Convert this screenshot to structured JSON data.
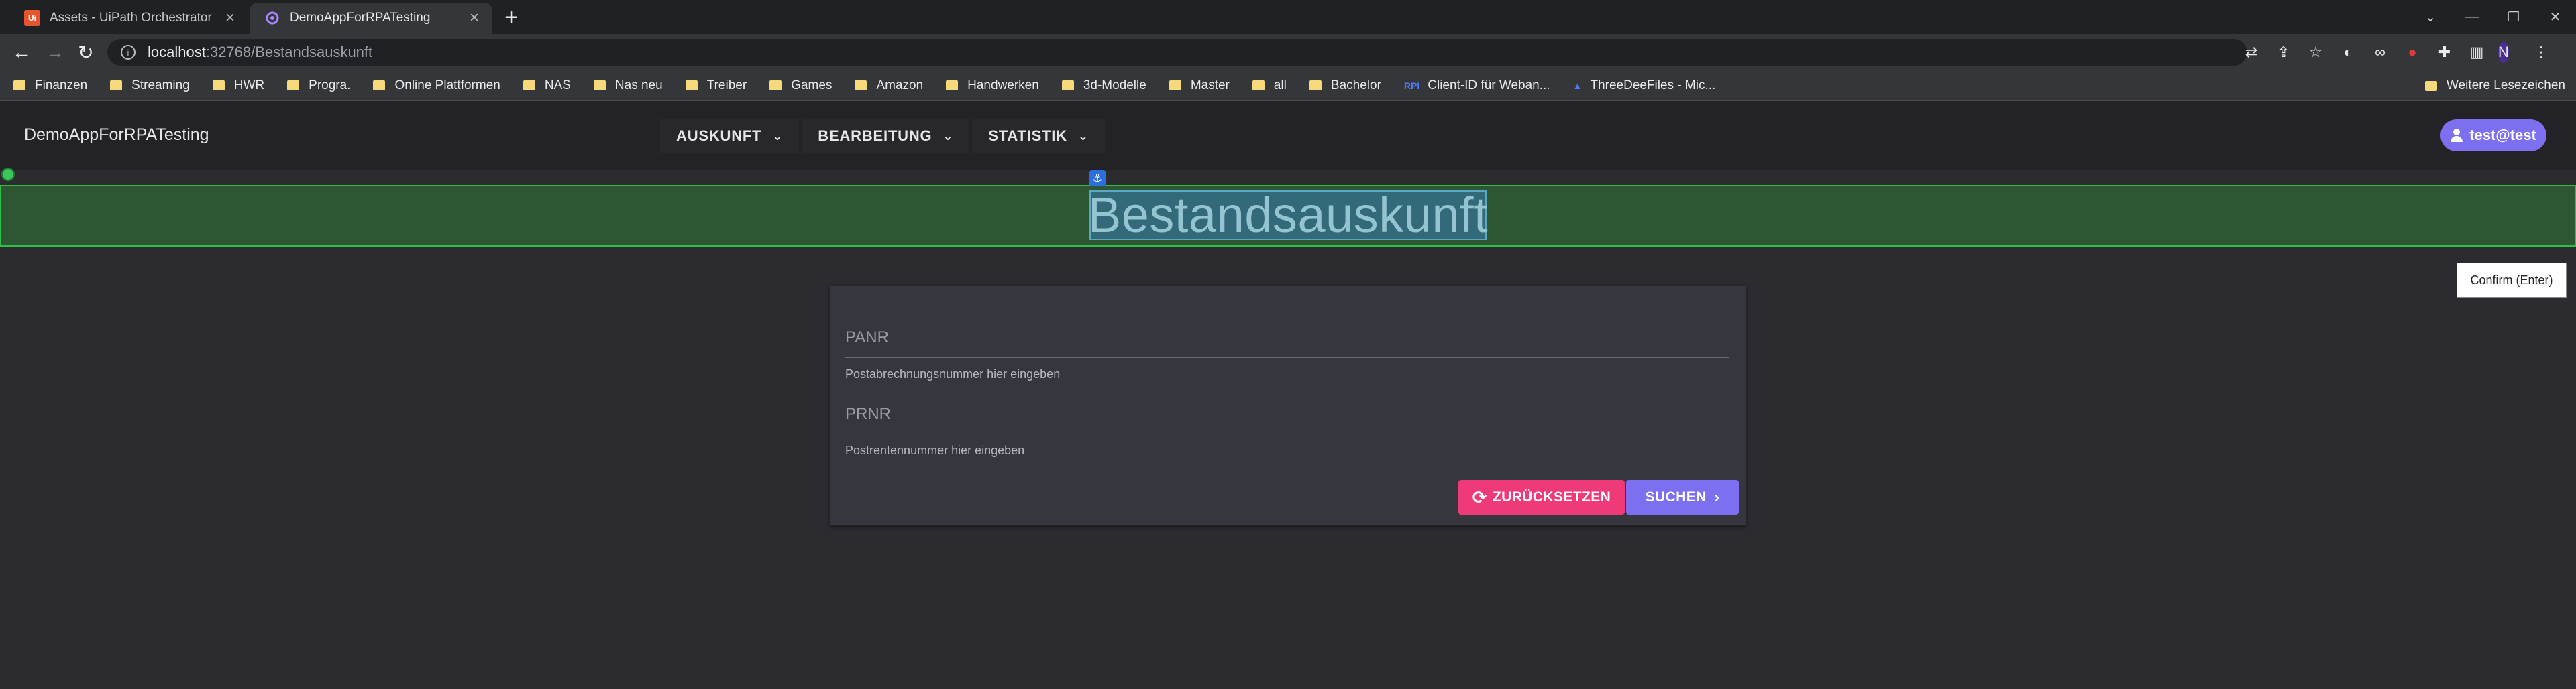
{
  "browser": {
    "tabs": [
      {
        "title": "Assets - UiPath Orchestrator",
        "favicon": "Ui",
        "active": false
      },
      {
        "title": "DemoAppForRPATesting",
        "favicon": "blazor-icon",
        "active": true
      }
    ],
    "address": {
      "host": "localhost",
      "path": ":32768/Bestandsauskunft"
    },
    "bookmarks": [
      "Finanzen",
      "Streaming",
      "HWR",
      "Progra.",
      "Online Plattformen",
      "NAS",
      "Nas neu",
      "Treiber",
      "Games",
      "Amazon",
      "Handwerken",
      "3d-Modelle",
      "Master",
      "all",
      "Bachelor",
      "Client-ID für Weban...",
      "ThreeDeeFiles - Mic..."
    ],
    "bookmarks_other": "Weitere Lesezeichen",
    "profile_initial": "N"
  },
  "app": {
    "brand": "DemoAppForRPATesting",
    "nav": [
      "AUSKUNFT",
      "BEARBEITUNG",
      "STATISTIK"
    ],
    "user": "test@test"
  },
  "page": {
    "title": "Bestandsauskunft",
    "confirm_label": "Confirm (Enter)"
  },
  "form": {
    "panr": {
      "label": "PANR",
      "hint": "Postabrechnungsnummer hier eingeben"
    },
    "prnr": {
      "label": "PRNR",
      "hint": "Postrentennummer hier eingeben"
    },
    "reset_label": "ZURÜCKSETZEN",
    "search_label": "SUCHEN"
  },
  "colors": {
    "accent": "#7c6ff0",
    "reset": "#ee3a78",
    "selection_band": "#2d5733",
    "selection_border": "#2fbf48"
  }
}
